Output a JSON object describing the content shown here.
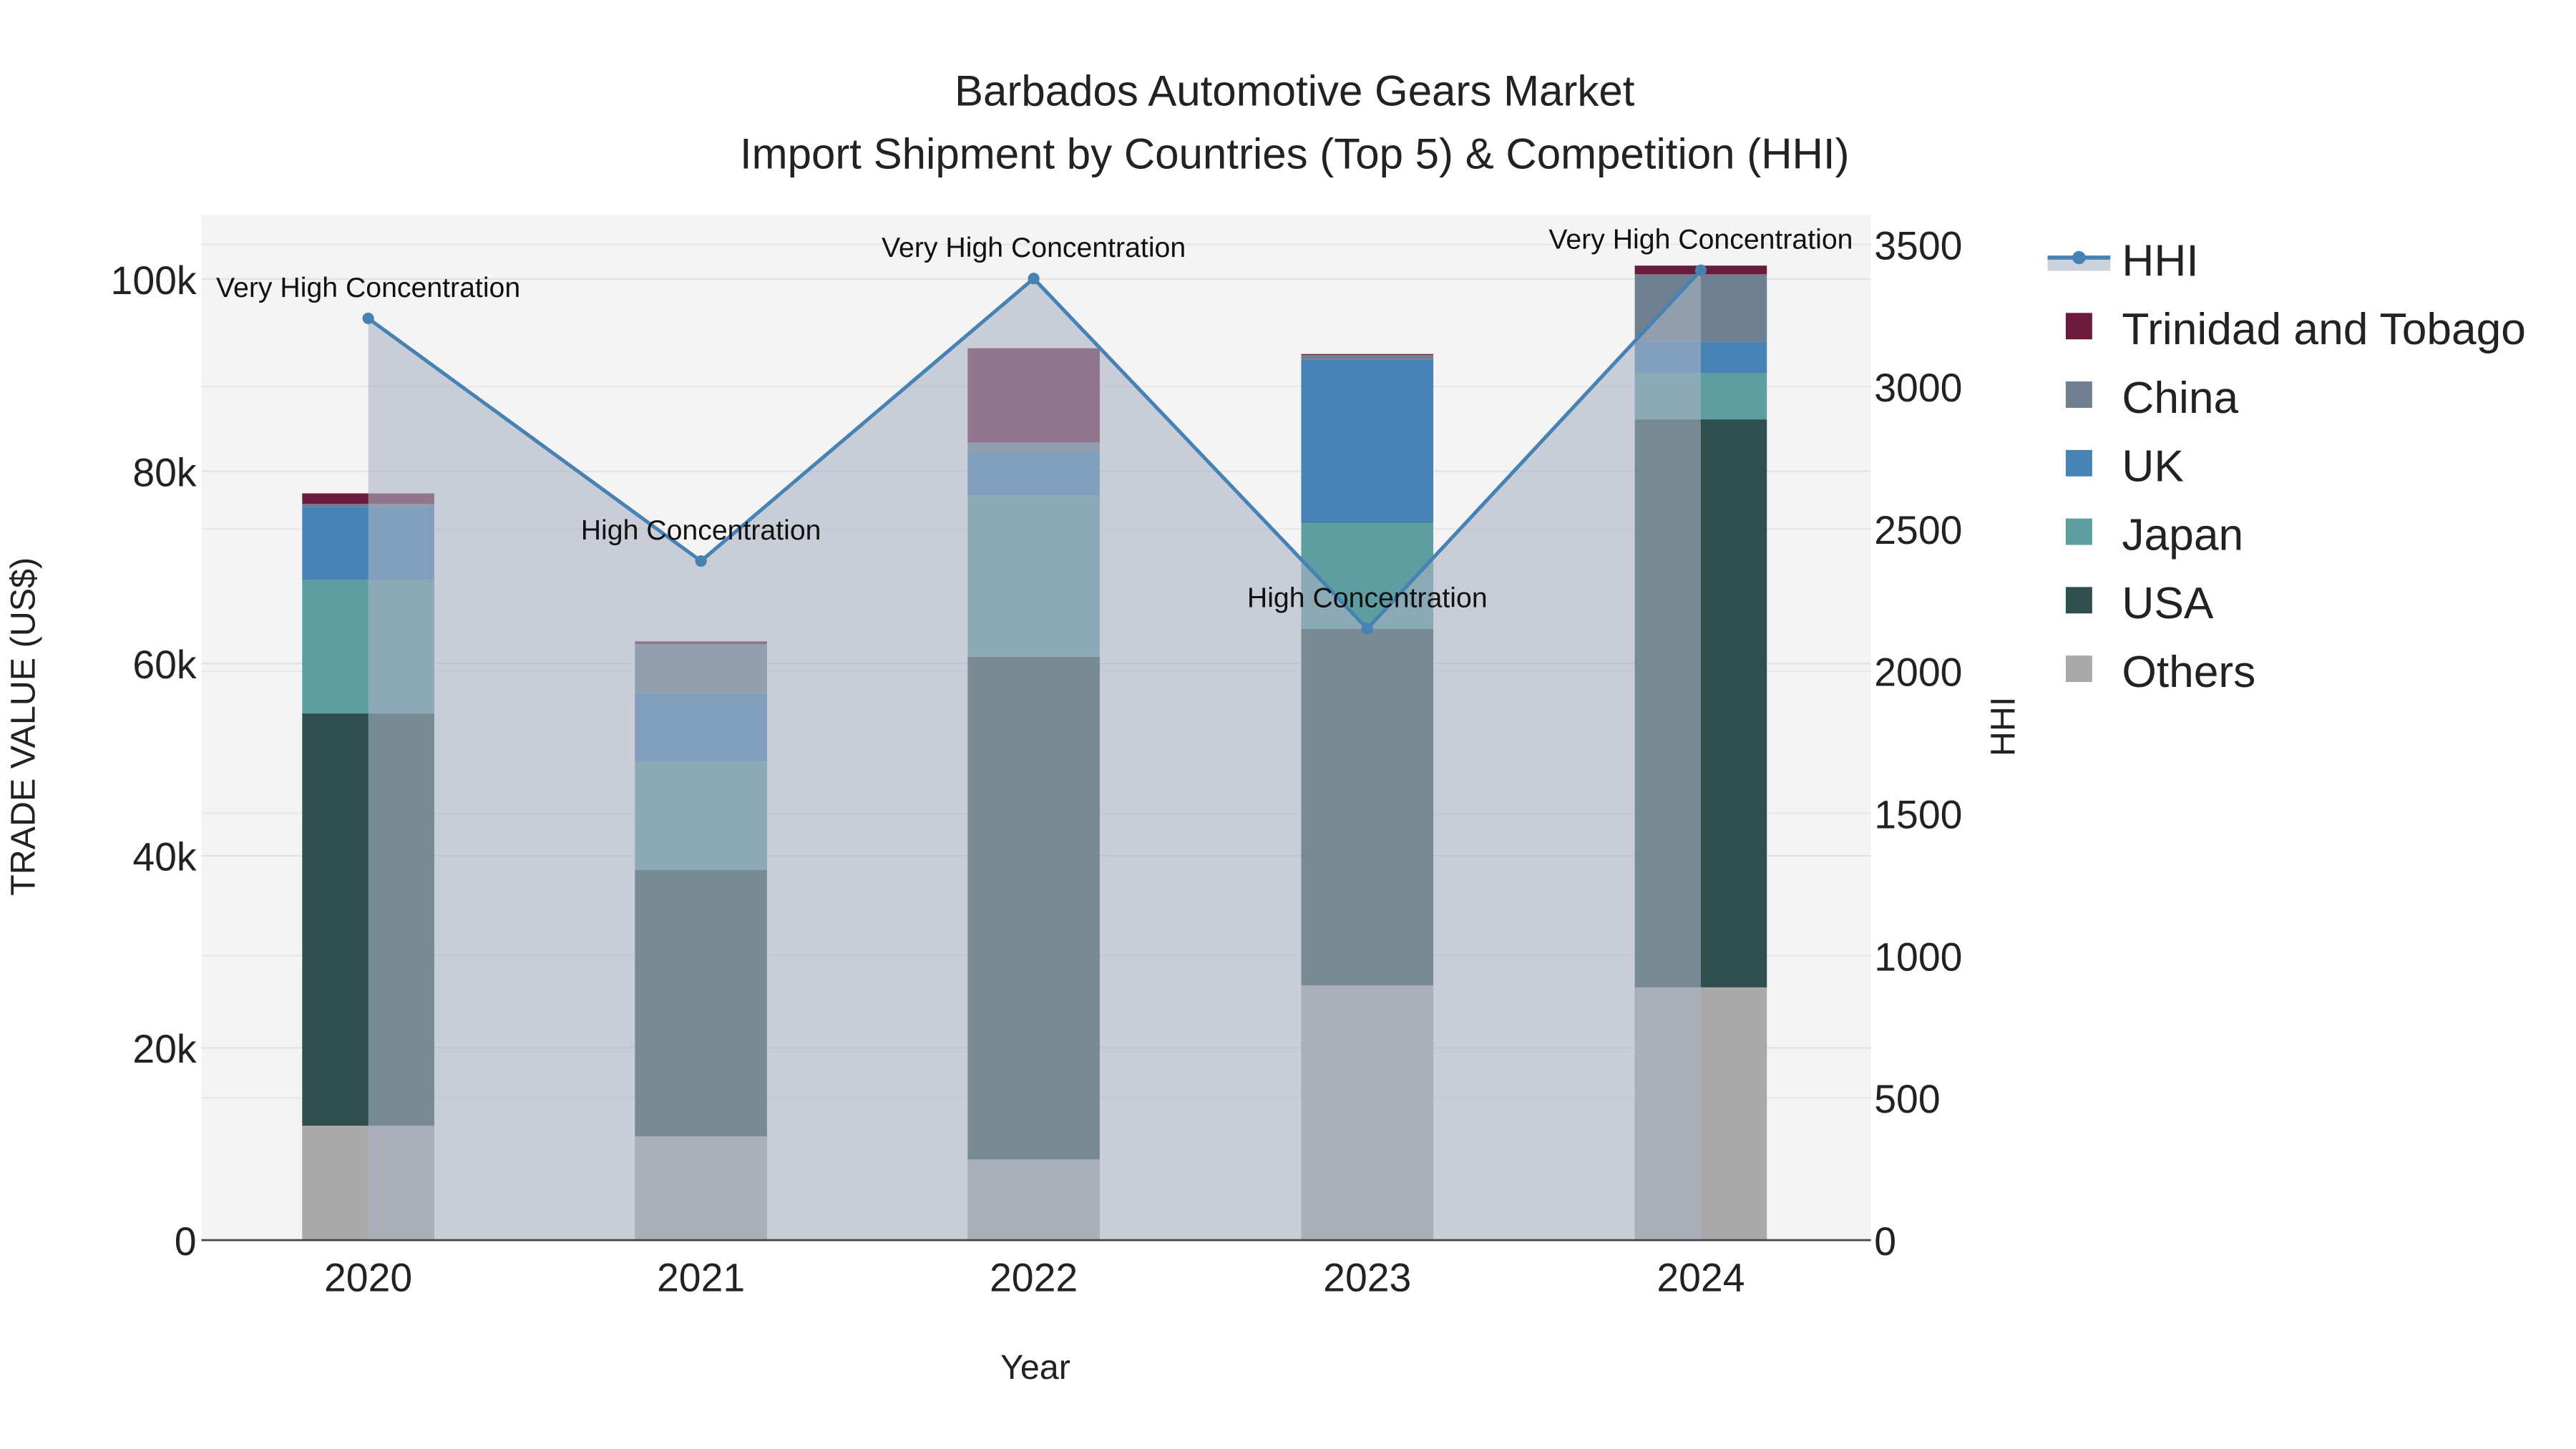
{
  "chart_data": {
    "type": "bar",
    "stacked": true,
    "title": "Barbados Automotive Gears Market",
    "subtitle": "Import Shipment by Countries (Top 5) & Competition (HHI)",
    "xlabel": "Year",
    "ylabel": "TRADE VALUE (US$)",
    "y2label": "HHI",
    "categories": [
      "2020",
      "2021",
      "2022",
      "2023",
      "2024"
    ],
    "ylim": [
      0,
      106000
    ],
    "y2lim": [
      0,
      3600
    ],
    "yticks": [
      0,
      20000,
      40000,
      60000,
      80000,
      100000
    ],
    "ytick_labels": [
      "0",
      "20k",
      "40k",
      "60k",
      "80k",
      "100k"
    ],
    "y2ticks": [
      0,
      500,
      1000,
      1500,
      2000,
      2500,
      3000,
      3500
    ],
    "y2tick_labels": [
      "0",
      "500",
      "1000",
      "1500",
      "2000",
      "2500",
      "3000",
      "3500"
    ],
    "series": [
      {
        "name": "Others",
        "color": "#a9a9a9",
        "values": [
          11900,
          10800,
          8400,
          26500,
          26300
        ]
      },
      {
        "name": "USA",
        "color": "#2f4f4f",
        "values": [
          42900,
          27700,
          52300,
          37100,
          59100
        ]
      },
      {
        "name": "Japan",
        "color": "#5f9ea0",
        "values": [
          13900,
          11300,
          16800,
          11000,
          4800
        ]
      },
      {
        "name": "UK",
        "color": "#4682b4",
        "values": [
          7600,
          7100,
          4600,
          17000,
          3300
        ]
      },
      {
        "name": "China",
        "color": "#708090",
        "values": [
          300,
          5100,
          900,
          500,
          7000
        ]
      },
      {
        "name": "Trinidad and Tobago",
        "color": "#6b1a3c",
        "values": [
          1100,
          300,
          9800,
          100,
          900
        ]
      }
    ],
    "hhi": {
      "name": "HHI",
      "color": "#4682b4",
      "values": [
        3240,
        2387,
        3380,
        2149,
        3409
      ],
      "annotations": [
        "Very High Concentration",
        "High Concentration",
        "Very High Concentration",
        "High Concentration",
        "Very High Concentration"
      ]
    },
    "legend": [
      "HHI",
      "Trinidad and Tobago",
      "China",
      "UK",
      "Japan",
      "USA",
      "Others"
    ],
    "legend_position": "right",
    "grid": true
  }
}
